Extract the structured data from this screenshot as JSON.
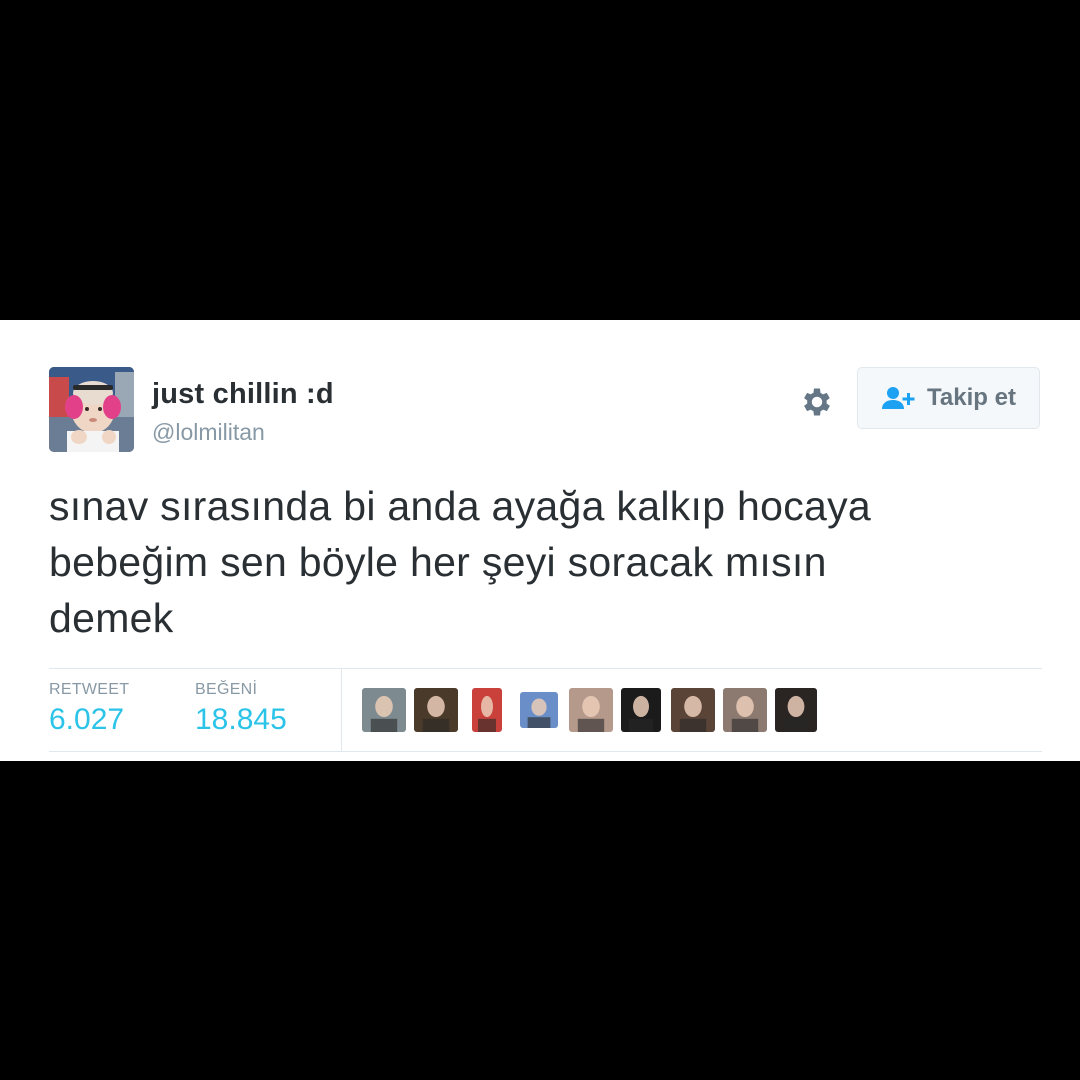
{
  "user": {
    "name": "just chillin :d",
    "handle": "@lolmilitan",
    "avatar_icon": "baby-with-pink-earmuffs-avatar"
  },
  "actions": {
    "settings_icon": "gear-icon",
    "follow_icon": "add-user-icon",
    "follow_label": "Takip et"
  },
  "tweet": {
    "lines": [
      "sınav sırasında bi anda ayağa kalkıp hocaya",
      "bebeğim sen böyle her şeyi soracak mısın",
      "demek"
    ]
  },
  "stats": {
    "retweet_label": "RETWEET",
    "retweet_count": "6.027",
    "likes_label": "BEĞENİ",
    "likes_count": "18.845"
  },
  "likers": [
    {
      "icon": "liker-avatar-1",
      "bg": "#7d8a8f"
    },
    {
      "icon": "liker-avatar-2",
      "bg": "#4a3a2a"
    },
    {
      "icon": "liker-avatar-3",
      "bg": "#c9413a"
    },
    {
      "icon": "liker-avatar-4",
      "bg": "#6a8fc8"
    },
    {
      "icon": "liker-avatar-5",
      "bg": "#b59a8c"
    },
    {
      "icon": "liker-avatar-6",
      "bg": "#1b1b1b"
    },
    {
      "icon": "liker-avatar-7",
      "bg": "#5a4438"
    },
    {
      "icon": "liker-avatar-8",
      "bg": "#8c7a70"
    },
    {
      "icon": "liker-avatar-9",
      "bg": "#2a2522"
    }
  ],
  "colors": {
    "background": "#000000",
    "card": "#ffffff",
    "accent": "#2bc3e8",
    "follow_icon": "#1da1f2",
    "text": "#292f33",
    "muted": "#8899a6"
  }
}
